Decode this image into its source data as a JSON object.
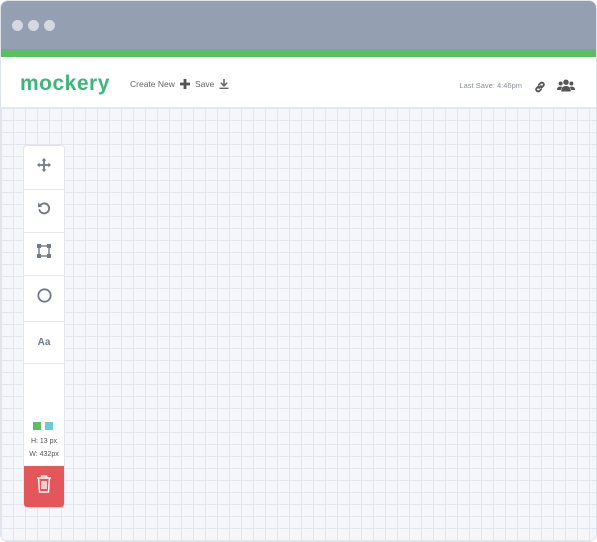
{
  "header": {
    "logo": "mockery",
    "create_new_label": "Create New",
    "save_label": "Save",
    "last_save": "Last Save: 4:46pm"
  },
  "toolbar": {
    "tools": [
      {
        "name": "move",
        "icon": "move-icon"
      },
      {
        "name": "undo",
        "icon": "undo-icon"
      },
      {
        "name": "rectangle",
        "icon": "rectangle-icon"
      },
      {
        "name": "circle",
        "icon": "circle-icon"
      },
      {
        "name": "text",
        "icon": "text-icon",
        "label": "Aa"
      }
    ],
    "colors": [
      "#5cbd62",
      "#6dcad3"
    ],
    "height_label": "H: 13 px",
    "width_label": "W: 432px",
    "delete_icon": "trash-icon"
  },
  "colors": {
    "brand": "#3fb57b",
    "accent_bar": "#5cbd62",
    "titlebar": "#94a0b2",
    "delete": "#e3575b"
  }
}
